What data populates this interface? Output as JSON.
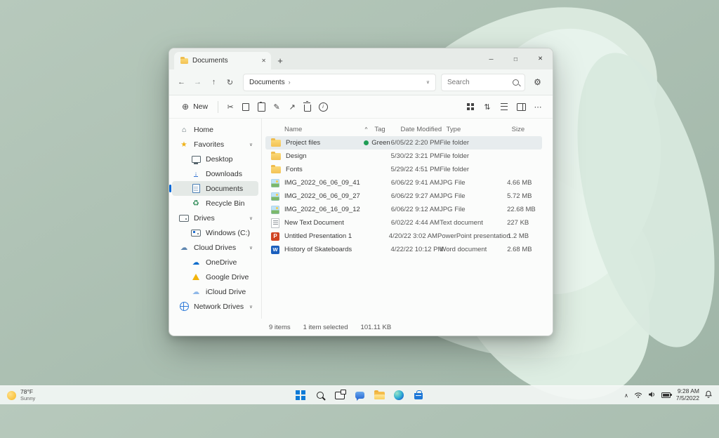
{
  "glyphs": {
    "back": "←",
    "forward": "→",
    "up": "↑",
    "refresh": "↻",
    "breadcrumb_sep": "›",
    "caret_down": "∨",
    "caret_up": "∧",
    "sort_caret": "^",
    "gear": "⚙",
    "tab_plus": "+",
    "new_plus": "⊕",
    "cut": "✂",
    "rename": "✎",
    "share": "↗",
    "sort": "⇅",
    "more": "⋯",
    "minimize": "─",
    "maximize": "□",
    "close": "✕",
    "home": "⌂",
    "star": "★",
    "cloud": "☁",
    "recycle": "♻",
    "download_arrow": "↓",
    "info_i": "i",
    "ppt_letter": "P",
    "word_letter": "W"
  },
  "window": {
    "tab_title": "Documents",
    "nav": {
      "address": "Documents",
      "search_placeholder": "Search"
    },
    "toolbar": {
      "new_label": "New"
    },
    "sidebar": {
      "items": [
        {
          "label": "Home"
        },
        {
          "label": "Favorites"
        },
        {
          "label": "Desktop"
        },
        {
          "label": "Downloads"
        },
        {
          "label": "Documents"
        },
        {
          "label": "Recycle Bin"
        },
        {
          "label": "Drives"
        },
        {
          "label": "Windows (C:)"
        },
        {
          "label": "Cloud Drives"
        },
        {
          "label": "OneDrive"
        },
        {
          "label": "Google Drive"
        },
        {
          "label": "iCloud Drive"
        },
        {
          "label": "Network Drives"
        }
      ]
    },
    "files": {
      "columns": {
        "name": "Name",
        "tag": "Tag",
        "date": "Date Modified",
        "type": "Type",
        "size": "Size"
      },
      "rows": [
        {
          "name": "Project files",
          "tag": "Green",
          "date": "6/05/22 2:20 PM",
          "type": "File folder",
          "size": "",
          "icon": "folder",
          "selected": true
        },
        {
          "name": "Design",
          "tag": "",
          "date": "5/30/22 3:21 PM",
          "type": "File folder",
          "size": "",
          "icon": "folder"
        },
        {
          "name": "Fonts",
          "tag": "",
          "date": "5/29/22 4:51 PM",
          "type": "File folder",
          "size": "",
          "icon": "folder"
        },
        {
          "name": "IMG_2022_06_06_09_41",
          "tag": "",
          "date": "6/06/22 9:41 AM",
          "type": "JPG File",
          "size": "4.66 MB",
          "icon": "image"
        },
        {
          "name": "IMG_2022_06_06_09_27",
          "tag": "",
          "date": "6/06/22 9:27 AM",
          "type": "JPG File",
          "size": "5.72 MB",
          "icon": "image"
        },
        {
          "name": "IMG_2022_06_16_09_12",
          "tag": "",
          "date": "6/06/22 9:12 AM",
          "type": "JPG File",
          "size": "22.68 MB",
          "icon": "image"
        },
        {
          "name": "New Text Document",
          "tag": "",
          "date": "6/02/22 4:44 AM",
          "type": "Text document",
          "size": "227 KB",
          "icon": "text"
        },
        {
          "name": "Untitled Presentation 1",
          "tag": "",
          "date": "4/20/22 3:02 AM",
          "type": "PowerPoint presentation",
          "size": "1.2 MB",
          "icon": "ppt"
        },
        {
          "name": "History of Skateboards",
          "tag": "",
          "date": "4/22/22 10:12 PM",
          "type": "Word document",
          "size": "2.68 MB",
          "icon": "word"
        }
      ]
    },
    "status": {
      "count": "9 items",
      "selected": "1 item selected",
      "size": "101.11 KB"
    }
  },
  "taskbar": {
    "weather": {
      "temp": "78°F",
      "condition": "Sunny"
    },
    "clock": {
      "time": "9:28 AM",
      "date": "7/5/2022"
    }
  }
}
